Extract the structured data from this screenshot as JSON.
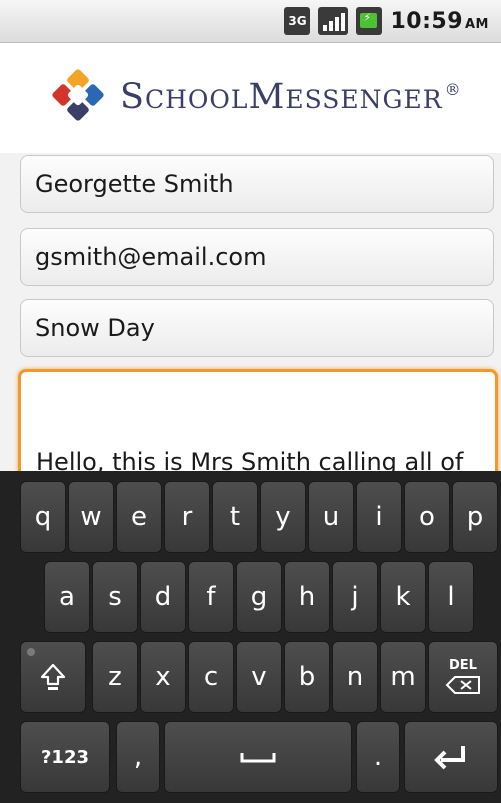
{
  "status_bar": {
    "network_label": "3G",
    "signal_icon": "signal-bars-icon",
    "battery_icon": "battery-charging-icon",
    "time": "10:59",
    "ampm": "AM"
  },
  "header": {
    "logo_icon": "schoolmessenger-logo-icon",
    "brand_name": "SchoolMessenger",
    "registered_mark": "®"
  },
  "form": {
    "name_value": "Georgette Smith",
    "email_value": "gsmith@email.com",
    "subject_value": "Snow Day",
    "message_value": "Hello, this is Mrs Smith calling all of"
  },
  "keyboard": {
    "row1": [
      "q",
      "w",
      "e",
      "r",
      "t",
      "y",
      "u",
      "i",
      "o",
      "p"
    ],
    "row2": [
      "a",
      "s",
      "d",
      "f",
      "g",
      "h",
      "j",
      "k",
      "l"
    ],
    "row3": [
      "z",
      "x",
      "c",
      "v",
      "b",
      "n",
      "m"
    ],
    "shift_icon": "shift-icon",
    "delete_label": "DEL",
    "delete_icon": "backspace-icon",
    "symbols_label": "?123",
    "comma_label": ",",
    "space_icon": "space-bar-icon",
    "period_label": ".",
    "enter_icon": "enter-icon"
  },
  "colors": {
    "focus_border": "#f19a2a",
    "keyboard_bg": "#222222",
    "key_bg": "#444444",
    "brand_text": "#3a3f6a"
  }
}
